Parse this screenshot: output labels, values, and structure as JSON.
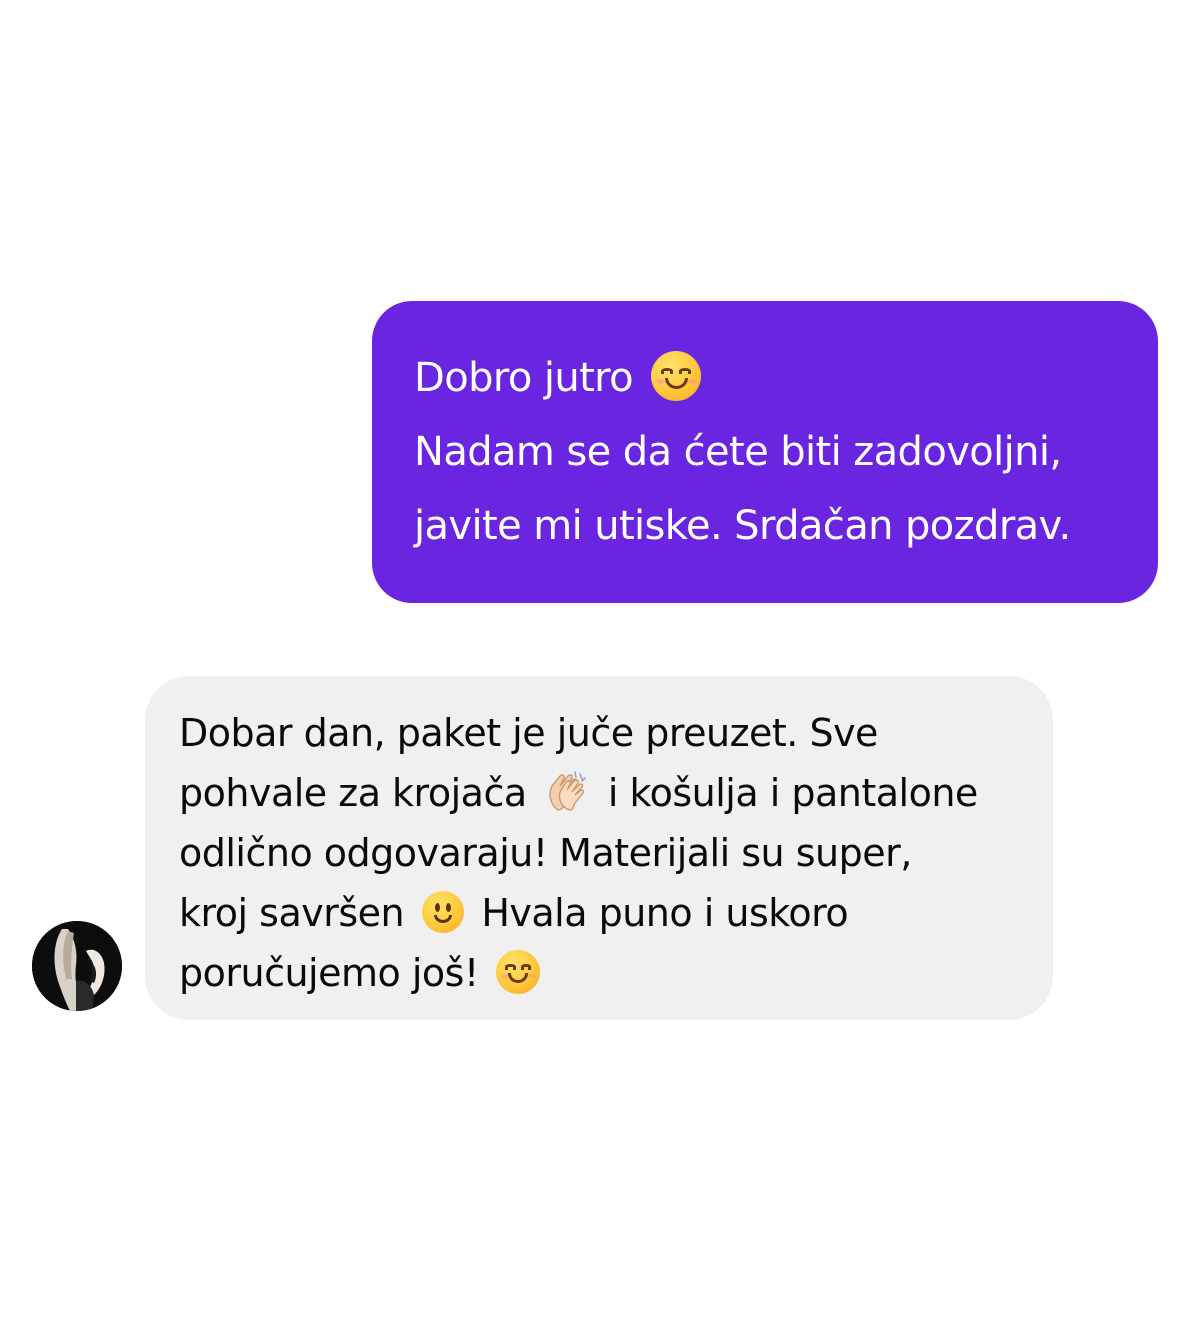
{
  "conversation": {
    "outgoing": {
      "lines": [
        "Dobro jutro",
        "Nadam se da ćete biti zadovoljni,",
        "javite mi utiske. Srdačan pozdrav."
      ],
      "bubble_color": "#6a25e0",
      "text_color": "#ffffff",
      "emoji_after_line_1": "smiling-face-icon"
    },
    "incoming": {
      "line1": "Dobar dan, paket je juče preuzet. Sve",
      "line2_a": "pohvale za krojača",
      "line2_b": "i košulja i pantalone",
      "line3": "odlično odgovaraju! Materijali su super,",
      "line4_a": "kroj savršen",
      "line4_b": "Hvala puno i uskoro",
      "line5": "poručujemo još!",
      "bubble_color": "#f0f0f0",
      "text_color": "#0a0a0a",
      "emojis": [
        "clapping-hands-icon",
        "slightly-smiling-face-icon",
        "smiling-face-icon"
      ]
    },
    "sender_avatar": {
      "icon": "contact-avatar"
    }
  }
}
